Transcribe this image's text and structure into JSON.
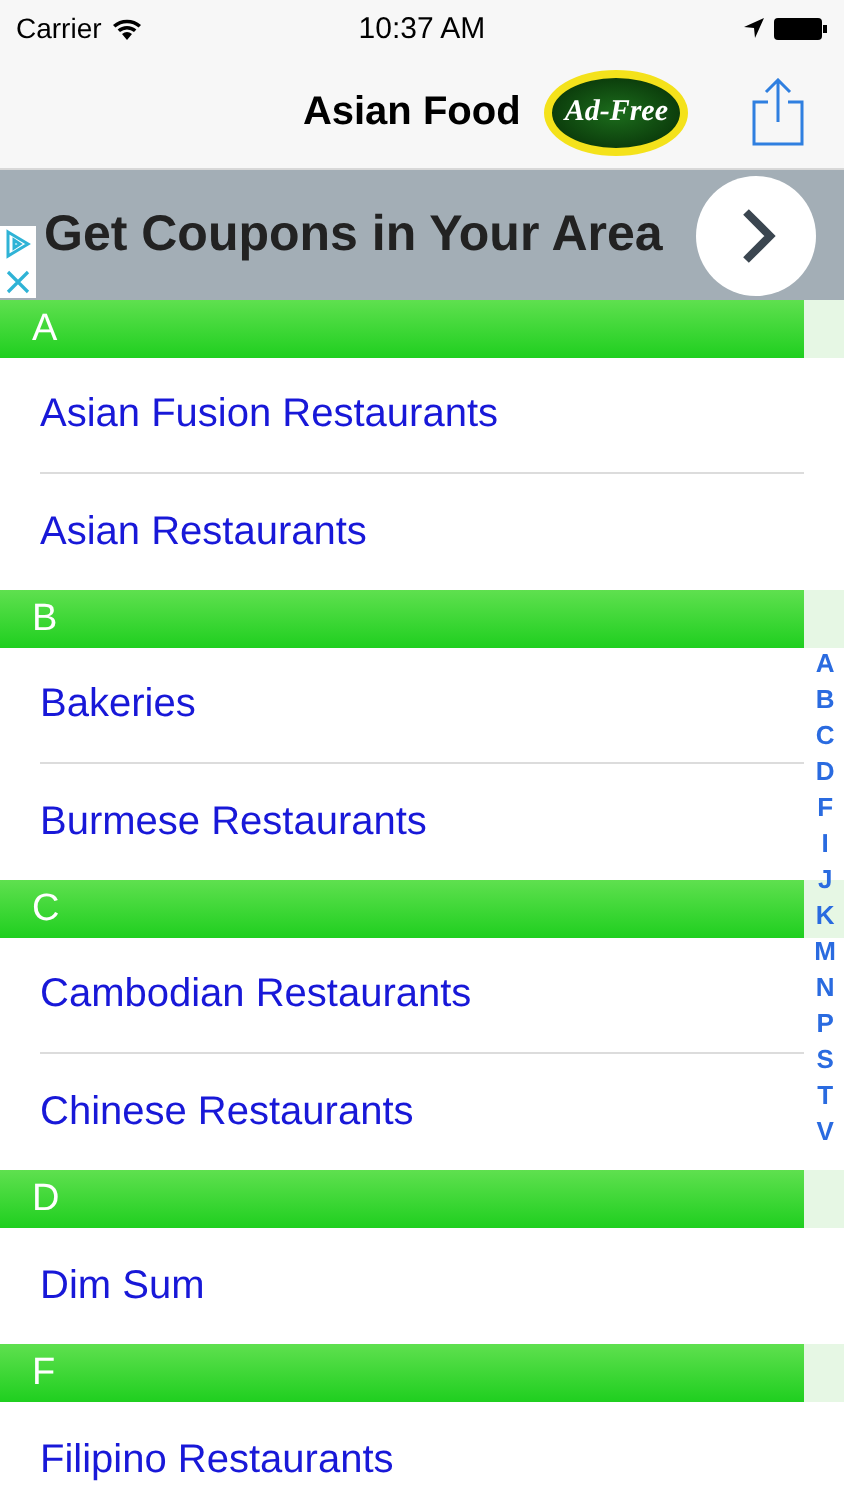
{
  "status_bar": {
    "carrier": "Carrier",
    "time": "10:37 AM"
  },
  "nav": {
    "title": "Asian Food",
    "badge": "Ad-Free"
  },
  "ad": {
    "text": "Get Coupons in Your Area"
  },
  "sections": [
    {
      "letter": "A",
      "items": [
        "Asian Fusion Restaurants",
        "Asian Restaurants"
      ]
    },
    {
      "letter": "B",
      "items": [
        "Bakeries",
        "Burmese Restaurants"
      ]
    },
    {
      "letter": "C",
      "items": [
        "Cambodian Restaurants",
        "Chinese Restaurants"
      ]
    },
    {
      "letter": "D",
      "items": [
        "Dim Sum"
      ]
    },
    {
      "letter": "F",
      "items": [
        "Filipino Restaurants"
      ]
    }
  ],
  "index": [
    "A",
    "B",
    "C",
    "D",
    "F",
    "I",
    "J",
    "K",
    "M",
    "N",
    "P",
    "S",
    "T",
    "V"
  ]
}
